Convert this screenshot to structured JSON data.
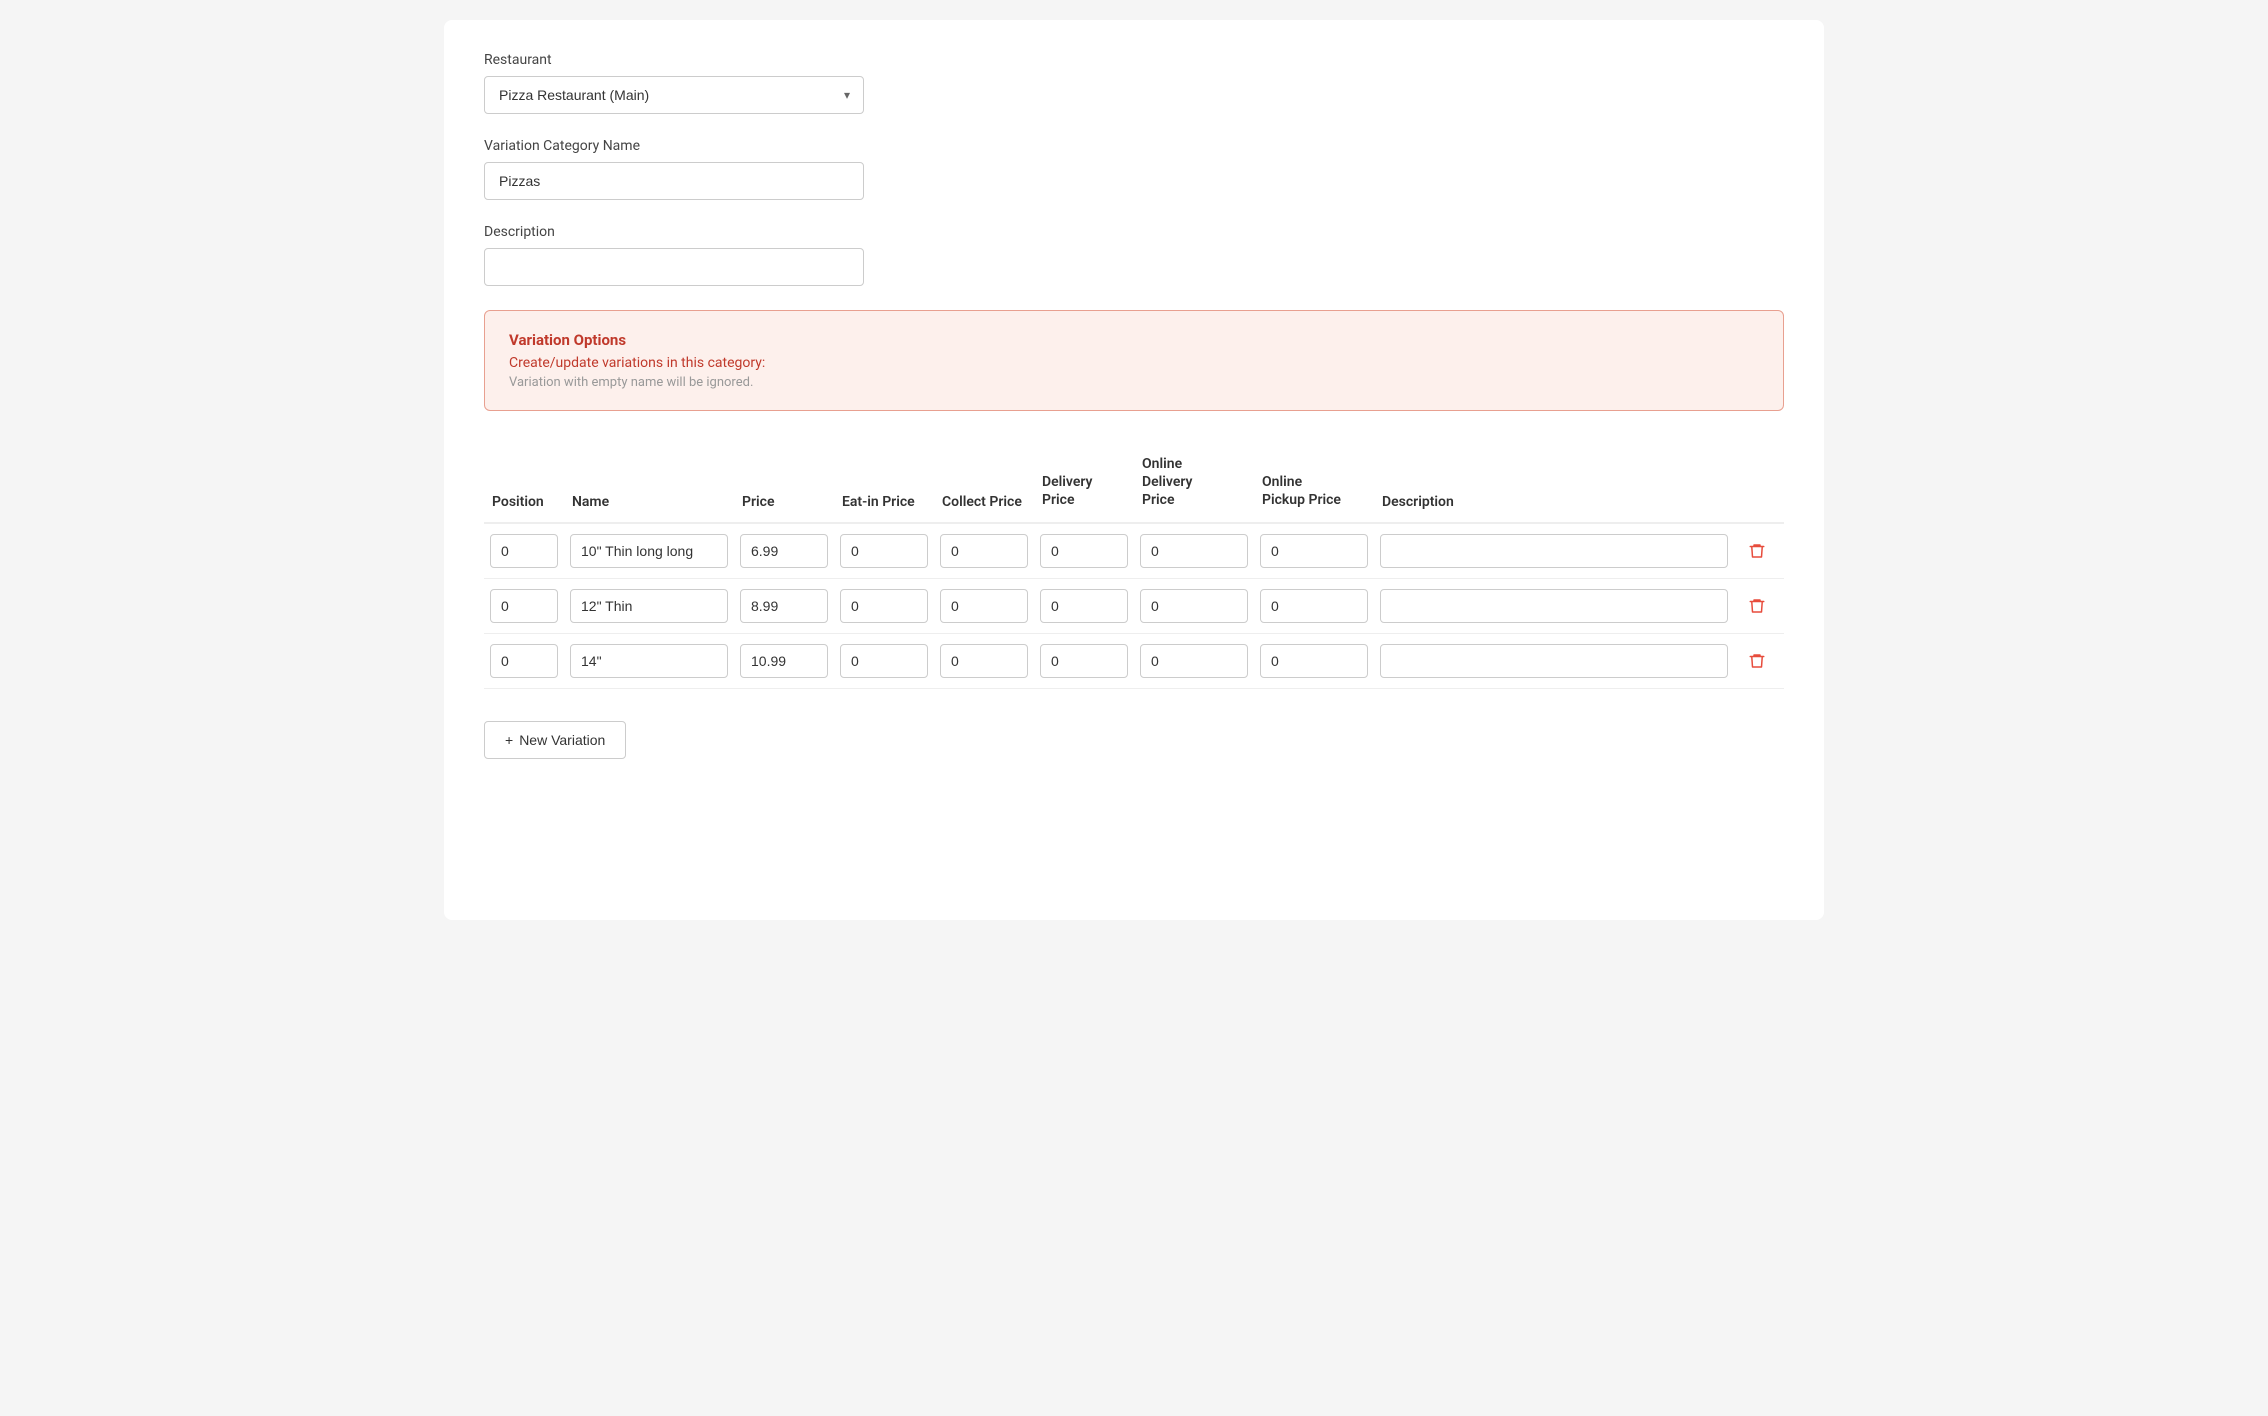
{
  "form": {
    "restaurant_label": "Restaurant",
    "restaurant_options": [
      "Pizza Restaurant (Main)"
    ],
    "restaurant_selected": "Pizza Restaurant (Main)",
    "variation_category_name_label": "Variation Category Name",
    "variation_category_name_value": "Pizzas",
    "description_label": "Description",
    "description_value": ""
  },
  "variation_options_box": {
    "title": "Variation Options",
    "subtitle": "Create/update variations in this category:",
    "hint": "Variation with empty name will be ignored."
  },
  "table": {
    "columns": [
      {
        "key": "position",
        "label": "Position"
      },
      {
        "key": "name",
        "label": "Name"
      },
      {
        "key": "price",
        "label": "Price"
      },
      {
        "key": "eatin_price",
        "label": "Eat-in Price"
      },
      {
        "key": "collect_price",
        "label": "Collect Price"
      },
      {
        "key": "delivery_price",
        "label": "Delivery Price"
      },
      {
        "key": "online_delivery_price",
        "label": "Online Delivery Price"
      },
      {
        "key": "online_pickup_price",
        "label": "Online Pickup Price"
      },
      {
        "key": "description",
        "label": "Description"
      }
    ],
    "rows": [
      {
        "position": "0",
        "name": "10\" Thin long long",
        "price": "6.99",
        "eatin_price": "0",
        "collect_price": "0",
        "delivery_price": "0",
        "online_delivery_price": "0",
        "online_pickup_price": "0",
        "description": ""
      },
      {
        "position": "0",
        "name": "12\" Thin",
        "price": "8.99",
        "eatin_price": "0",
        "collect_price": "0",
        "delivery_price": "0",
        "online_delivery_price": "0",
        "online_pickup_price": "0",
        "description": ""
      },
      {
        "position": "0",
        "name": "14\"",
        "price": "10.99",
        "eatin_price": "0",
        "collect_price": "0",
        "delivery_price": "0",
        "online_delivery_price": "0",
        "online_pickup_price": "0",
        "description": ""
      }
    ]
  },
  "buttons": {
    "new_variation_label": "+ New Variation"
  },
  "icons": {
    "chevron_down": "▾",
    "trash": "🗑",
    "plus": "+"
  }
}
